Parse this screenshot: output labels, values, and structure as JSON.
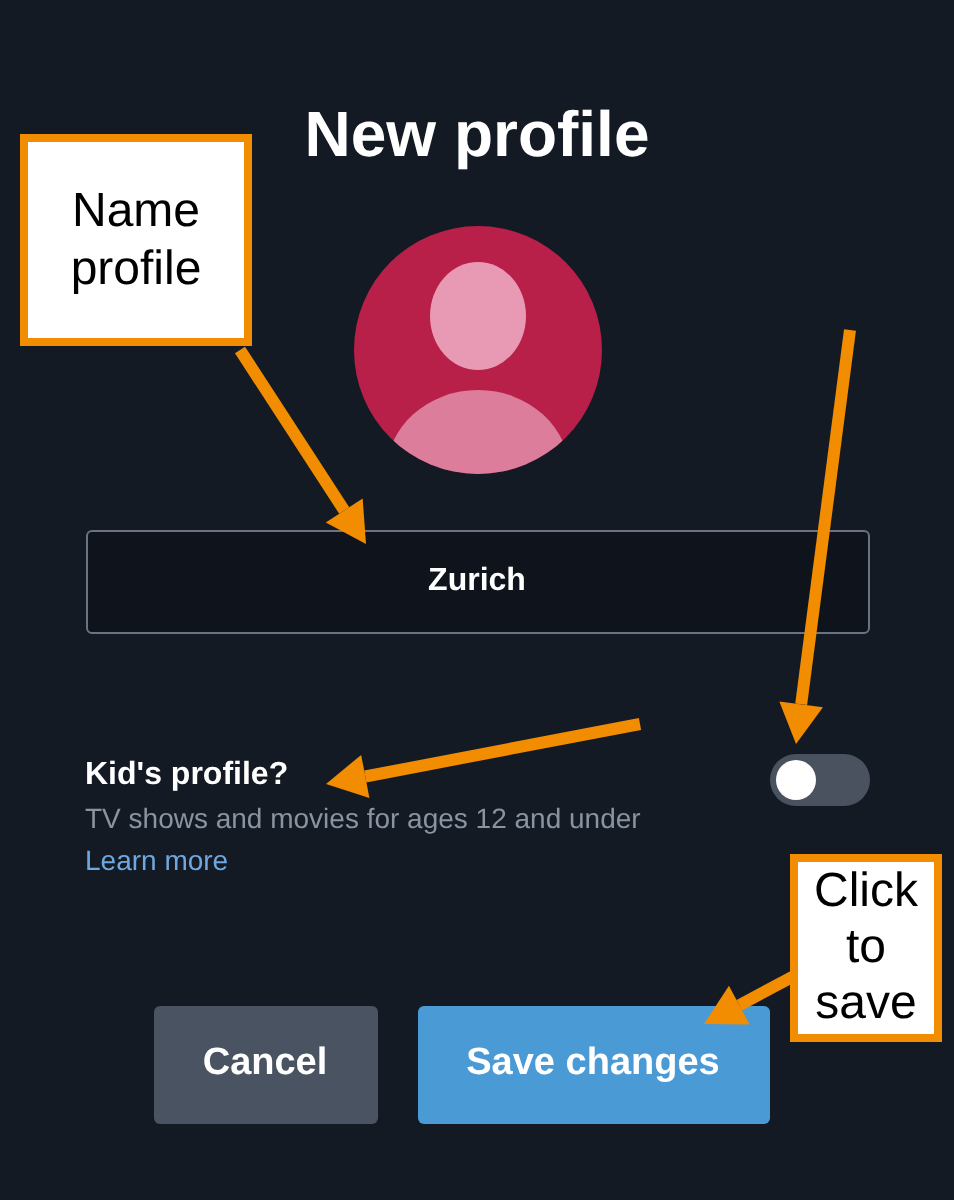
{
  "title": "New profile",
  "name_field": {
    "value": "Zurich"
  },
  "kids_profile": {
    "label": "Kid's profile?",
    "description": "TV shows and movies for ages 12 and under",
    "link": "Learn more",
    "on": false
  },
  "buttons": [
    {
      "label": "Cancel",
      "kind": "secondary"
    },
    {
      "label": "Save changes",
      "kind": "primary"
    }
  ],
  "callouts": [
    {
      "text": "Name profile",
      "kind": "left"
    },
    {
      "text": "Click to save",
      "kind": "right"
    }
  ]
}
